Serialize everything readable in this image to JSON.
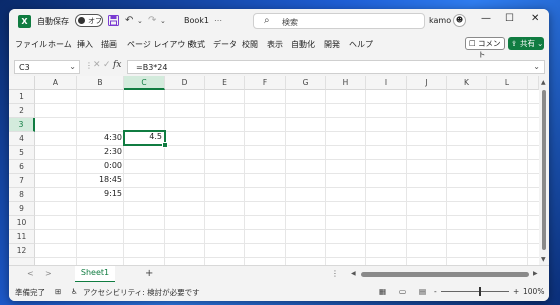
{
  "titlebar": {
    "app_icon": "X",
    "autosave_label": "自動保存",
    "autosave_state": "オフ",
    "save_icon": "floppy-icon",
    "undo_glyph": "↶",
    "redo_glyph": "↷",
    "more_glyph": "⌄",
    "filename": "Book1",
    "filename_suffix": "⋯",
    "search_placeholder": "検索",
    "user": "kamo",
    "avatar_glyph": "☻",
    "minimize": "—",
    "maximize": "☐",
    "close": "✕"
  },
  "menu": {
    "items": [
      "ファイル",
      "ホーム",
      "挿入",
      "描画",
      "ページ レイアウト",
      "数式",
      "データ",
      "校閲",
      "表示",
      "自動化",
      "開発",
      "ヘルプ"
    ],
    "comment_label": "コメント",
    "comment_icon": "☐",
    "share_label": "共有",
    "share_icon": "⇪",
    "share_chevron": "⌄"
  },
  "formula_bar": {
    "name_box": "C3",
    "dropdown": "⌄",
    "separator": "⋮",
    "cancel": "✕",
    "enter": "✓",
    "fx": "fx",
    "formula": "=B3*24",
    "expand": "⌄"
  },
  "sheet": {
    "columns": [
      "A",
      "B",
      "C",
      "D",
      "E",
      "F",
      "G",
      "H",
      "I",
      "J",
      "K",
      "L"
    ],
    "rows": [
      "1",
      "2",
      "3",
      "4",
      "5",
      "6",
      "7",
      "8",
      "9",
      "10",
      "11",
      "12"
    ],
    "active_column": "C",
    "active_row": "3",
    "cells": {
      "B3": "4:30",
      "C3": "4.5",
      "B4": "2:30",
      "B5": "0:00",
      "B6": "18:45",
      "B7": "9:15"
    }
  },
  "tabs": {
    "prev": "<",
    "next": ">",
    "sheet_name": "Sheet1",
    "add": "+",
    "options": "⋮"
  },
  "status": {
    "ready": "準備完了",
    "accessibility": "アクセシビリティ: 検討が必要です",
    "accessibility_icon": "♿",
    "cell_mode_icon": "⊞",
    "view_normal": "▦",
    "view_layout": "▭",
    "view_pagebreak": "▤",
    "zoom_minus": "-",
    "zoom_plus": "+",
    "zoom": "100%",
    "zoom_level_percent": 100
  },
  "colors": {
    "accent": "#107c41",
    "selection_header": "#d3ebdc"
  }
}
